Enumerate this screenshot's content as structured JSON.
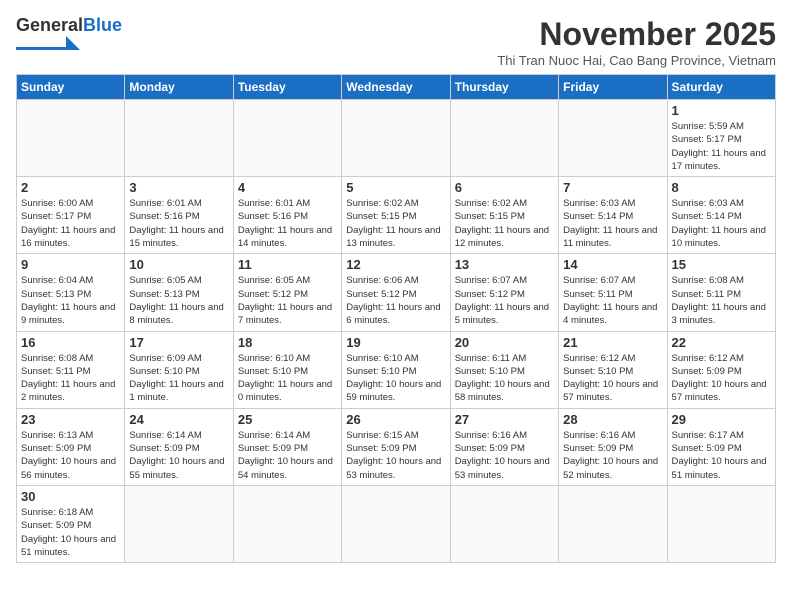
{
  "logo": {
    "text_general": "General",
    "text_blue": "Blue"
  },
  "title": "November 2025",
  "subtitle": "Thi Tran Nuoc Hai, Cao Bang Province, Vietnam",
  "days_of_week": [
    "Sunday",
    "Monday",
    "Tuesday",
    "Wednesday",
    "Thursday",
    "Friday",
    "Saturday"
  ],
  "weeks": [
    [
      {
        "day": "",
        "info": ""
      },
      {
        "day": "",
        "info": ""
      },
      {
        "day": "",
        "info": ""
      },
      {
        "day": "",
        "info": ""
      },
      {
        "day": "",
        "info": ""
      },
      {
        "day": "",
        "info": ""
      },
      {
        "day": "1",
        "info": "Sunrise: 5:59 AM\nSunset: 5:17 PM\nDaylight: 11 hours\nand 17 minutes."
      }
    ],
    [
      {
        "day": "2",
        "info": "Sunrise: 6:00 AM\nSunset: 5:17 PM\nDaylight: 11 hours\nand 16 minutes."
      },
      {
        "day": "3",
        "info": "Sunrise: 6:01 AM\nSunset: 5:16 PM\nDaylight: 11 hours\nand 15 minutes."
      },
      {
        "day": "4",
        "info": "Sunrise: 6:01 AM\nSunset: 5:16 PM\nDaylight: 11 hours\nand 14 minutes."
      },
      {
        "day": "5",
        "info": "Sunrise: 6:02 AM\nSunset: 5:15 PM\nDaylight: 11 hours\nand 13 minutes."
      },
      {
        "day": "6",
        "info": "Sunrise: 6:02 AM\nSunset: 5:15 PM\nDaylight: 11 hours\nand 12 minutes."
      },
      {
        "day": "7",
        "info": "Sunrise: 6:03 AM\nSunset: 5:14 PM\nDaylight: 11 hours\nand 11 minutes."
      },
      {
        "day": "8",
        "info": "Sunrise: 6:03 AM\nSunset: 5:14 PM\nDaylight: 11 hours\nand 10 minutes."
      }
    ],
    [
      {
        "day": "9",
        "info": "Sunrise: 6:04 AM\nSunset: 5:13 PM\nDaylight: 11 hours\nand 9 minutes."
      },
      {
        "day": "10",
        "info": "Sunrise: 6:05 AM\nSunset: 5:13 PM\nDaylight: 11 hours\nand 8 minutes."
      },
      {
        "day": "11",
        "info": "Sunrise: 6:05 AM\nSunset: 5:12 PM\nDaylight: 11 hours\nand 7 minutes."
      },
      {
        "day": "12",
        "info": "Sunrise: 6:06 AM\nSunset: 5:12 PM\nDaylight: 11 hours\nand 6 minutes."
      },
      {
        "day": "13",
        "info": "Sunrise: 6:07 AM\nSunset: 5:12 PM\nDaylight: 11 hours\nand 5 minutes."
      },
      {
        "day": "14",
        "info": "Sunrise: 6:07 AM\nSunset: 5:11 PM\nDaylight: 11 hours\nand 4 minutes."
      },
      {
        "day": "15",
        "info": "Sunrise: 6:08 AM\nSunset: 5:11 PM\nDaylight: 11 hours\nand 3 minutes."
      }
    ],
    [
      {
        "day": "16",
        "info": "Sunrise: 6:08 AM\nSunset: 5:11 PM\nDaylight: 11 hours\nand 2 minutes."
      },
      {
        "day": "17",
        "info": "Sunrise: 6:09 AM\nSunset: 5:10 PM\nDaylight: 11 hours\nand 1 minute."
      },
      {
        "day": "18",
        "info": "Sunrise: 6:10 AM\nSunset: 5:10 PM\nDaylight: 11 hours\nand 0 minutes."
      },
      {
        "day": "19",
        "info": "Sunrise: 6:10 AM\nSunset: 5:10 PM\nDaylight: 10 hours\nand 59 minutes."
      },
      {
        "day": "20",
        "info": "Sunrise: 6:11 AM\nSunset: 5:10 PM\nDaylight: 10 hours\nand 58 minutes."
      },
      {
        "day": "21",
        "info": "Sunrise: 6:12 AM\nSunset: 5:10 PM\nDaylight: 10 hours\nand 57 minutes."
      },
      {
        "day": "22",
        "info": "Sunrise: 6:12 AM\nSunset: 5:09 PM\nDaylight: 10 hours\nand 57 minutes."
      }
    ],
    [
      {
        "day": "23",
        "info": "Sunrise: 6:13 AM\nSunset: 5:09 PM\nDaylight: 10 hours\nand 56 minutes."
      },
      {
        "day": "24",
        "info": "Sunrise: 6:14 AM\nSunset: 5:09 PM\nDaylight: 10 hours\nand 55 minutes."
      },
      {
        "day": "25",
        "info": "Sunrise: 6:14 AM\nSunset: 5:09 PM\nDaylight: 10 hours\nand 54 minutes."
      },
      {
        "day": "26",
        "info": "Sunrise: 6:15 AM\nSunset: 5:09 PM\nDaylight: 10 hours\nand 53 minutes."
      },
      {
        "day": "27",
        "info": "Sunrise: 6:16 AM\nSunset: 5:09 PM\nDaylight: 10 hours\nand 53 minutes."
      },
      {
        "day": "28",
        "info": "Sunrise: 6:16 AM\nSunset: 5:09 PM\nDaylight: 10 hours\nand 52 minutes."
      },
      {
        "day": "29",
        "info": "Sunrise: 6:17 AM\nSunset: 5:09 PM\nDaylight: 10 hours\nand 51 minutes."
      }
    ],
    [
      {
        "day": "30",
        "info": "Sunrise: 6:18 AM\nSunset: 5:09 PM\nDaylight: 10 hours\nand 51 minutes."
      },
      {
        "day": "",
        "info": ""
      },
      {
        "day": "",
        "info": ""
      },
      {
        "day": "",
        "info": ""
      },
      {
        "day": "",
        "info": ""
      },
      {
        "day": "",
        "info": ""
      },
      {
        "day": "",
        "info": ""
      }
    ]
  ]
}
